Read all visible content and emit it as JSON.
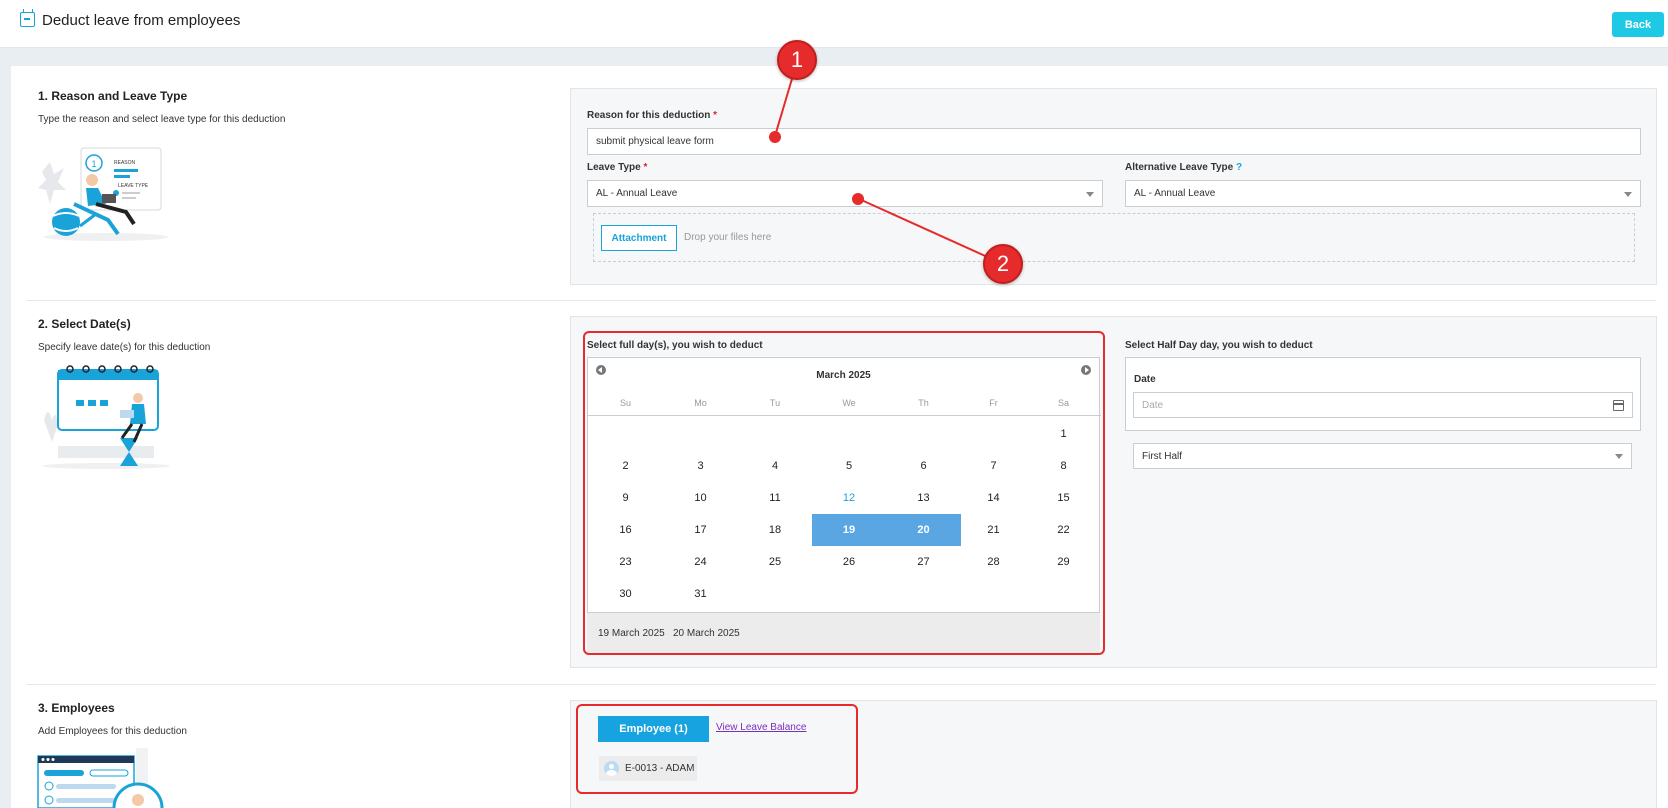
{
  "header": {
    "title": "Deduct leave from employees",
    "back_label": "Back"
  },
  "section1": {
    "title": "1. Reason and Leave Type",
    "desc": "Type the reason and select leave type for this deduction",
    "illustration": {
      "label_1": "1",
      "label_reason": "REASON",
      "label_leave_type": "LEAVE TYPE"
    },
    "reason_label": "Reason for this deduction",
    "reason_value": "submit physical leave form",
    "leave_type_label": "Leave Type",
    "leave_type_value": "AL - Annual Leave",
    "alt_leave_type_label": "Alternative Leave Type",
    "alt_leave_type_value": "AL - Annual Leave",
    "attachment_label": "Attachment",
    "drop_hint": "Drop your files here",
    "required_mark": "*",
    "help_mark": "?"
  },
  "section2": {
    "title": "2. Select Date(s)",
    "desc": "Specify leave date(s) for this deduction",
    "full_day_label": "Select full day(s), you wish to deduct",
    "half_day_label": "Select Half Day day, you wish to deduct",
    "calendar": {
      "month": "March 2025",
      "weekdays": [
        "Su",
        "Mo",
        "Tu",
        "We",
        "Th",
        "Fr",
        "Sa"
      ],
      "days": [
        "",
        "",
        "",
        "",
        "",
        "",
        "1",
        "2",
        "3",
        "4",
        "5",
        "6",
        "7",
        "8",
        "9",
        "10",
        "11",
        "12",
        "13",
        "14",
        "15",
        "16",
        "17",
        "18",
        "19",
        "20",
        "21",
        "22",
        "23",
        "24",
        "25",
        "26",
        "27",
        "28",
        "29",
        "30",
        "31",
        "",
        "",
        "",
        "",
        ""
      ],
      "today": "12",
      "selected": [
        "19",
        "20"
      ]
    },
    "selected_dates": [
      "19 March 2025",
      "20 March 2025"
    ],
    "date_label": "Date",
    "date_placeholder": "Date",
    "half_value": "First Half"
  },
  "section3": {
    "title": "3. Employees",
    "desc": "Add Employees for this deduction",
    "employee_button": "Employee (1)",
    "view_balance_link": "View Leave Balance",
    "employee_chip": "E-0013 - ADAM"
  },
  "annotations": {
    "marker1": "1",
    "marker2": "2"
  },
  "colors": {
    "accent": "#1aa3d9",
    "back_button": "#1ec9e6",
    "selected_day": "#5aa6e3",
    "annotation_red": "#e52b2b",
    "link": "#7b2fbf"
  }
}
